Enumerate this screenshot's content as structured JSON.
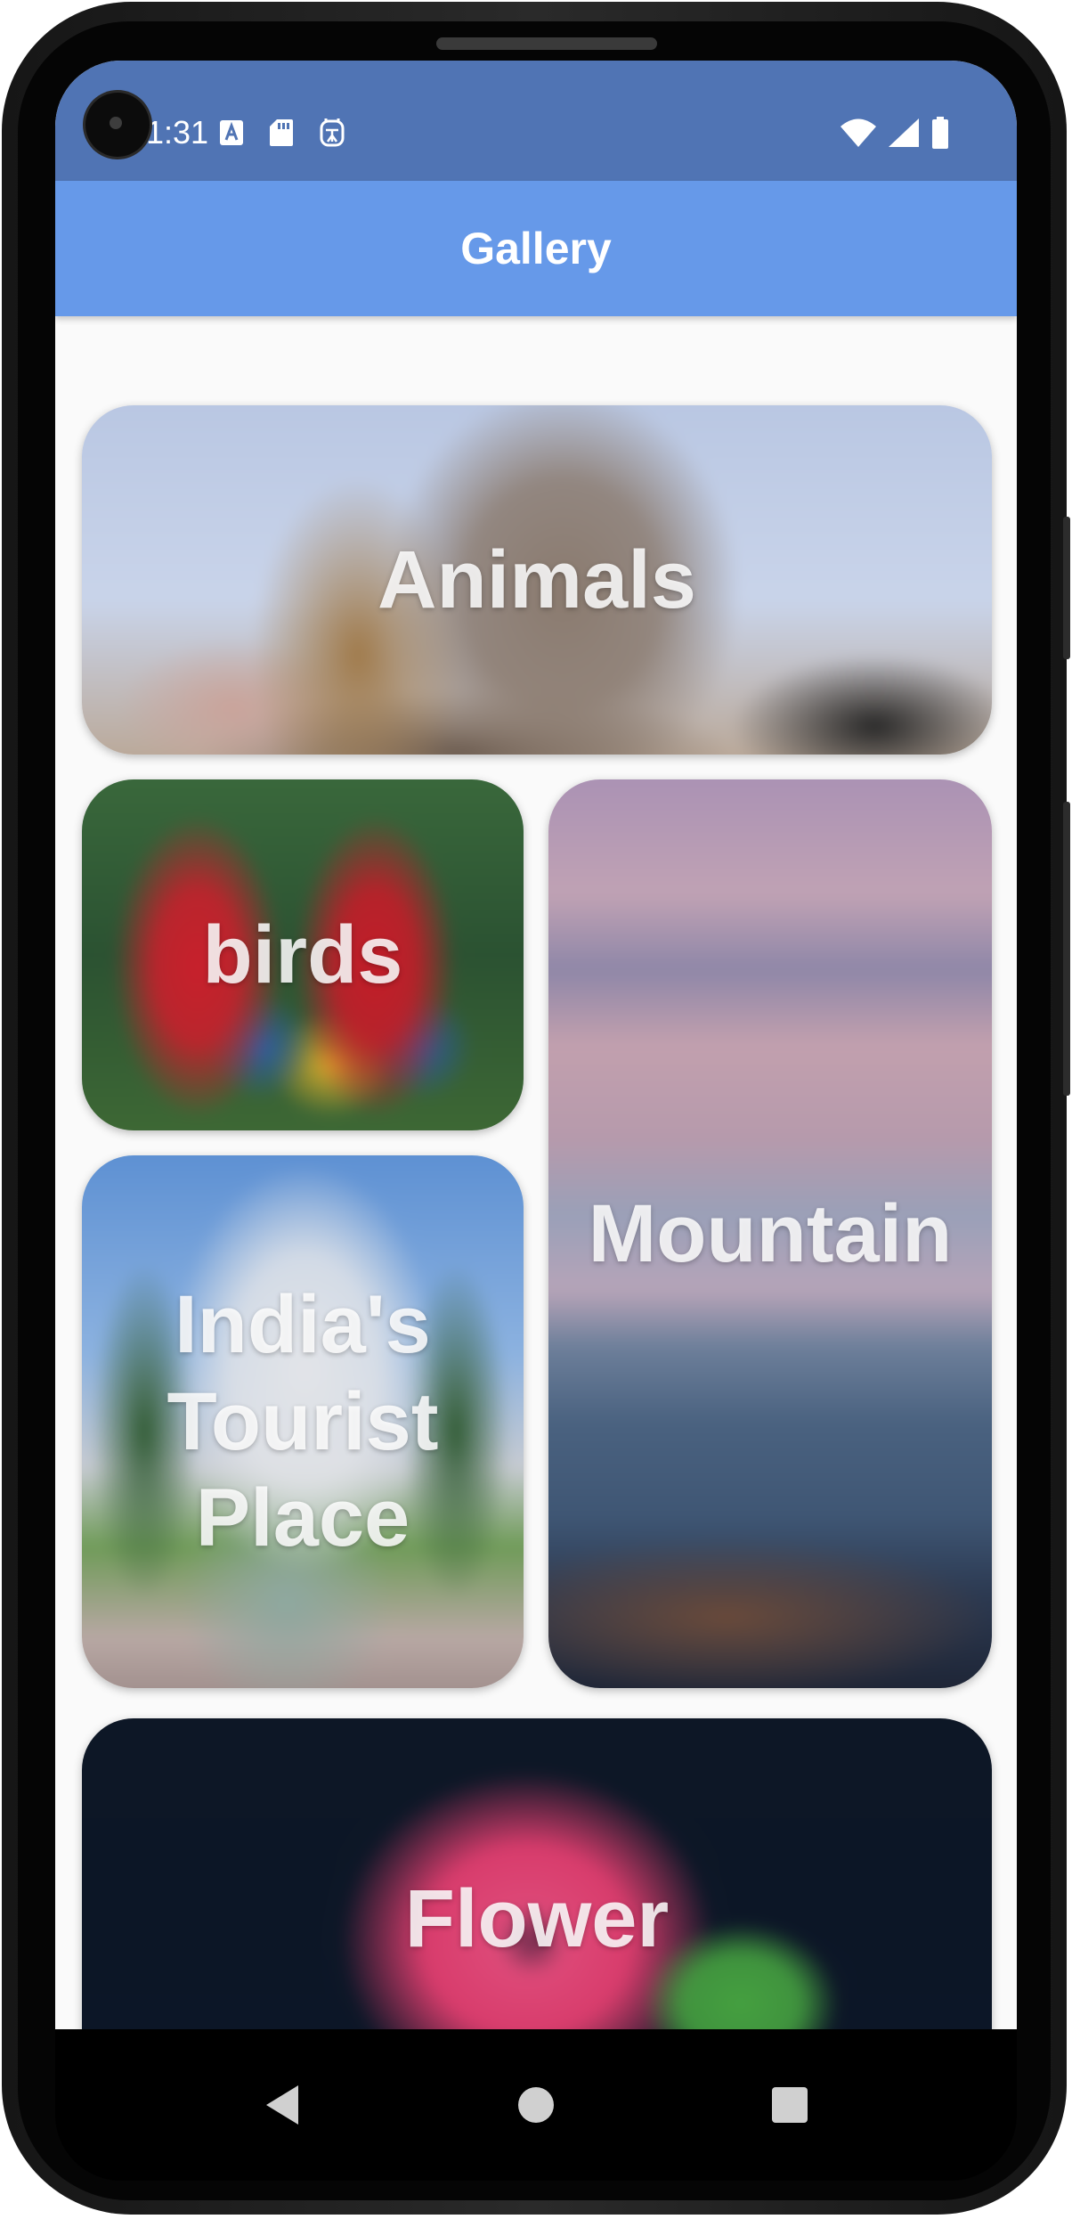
{
  "status_bar": {
    "time": "1:31",
    "left_icons": [
      "font-a-icon",
      "sd-card-icon",
      "accessibility-icon"
    ],
    "right_icons": [
      "wifi-icon",
      "signal-icon",
      "battery-icon"
    ]
  },
  "app_bar": {
    "title": "Gallery"
  },
  "gallery": {
    "items": [
      {
        "label": "Animals"
      },
      {
        "label": "birds"
      },
      {
        "label": "Mountain"
      },
      {
        "label": "India's Tourist Place"
      },
      {
        "label": "Flower"
      }
    ]
  },
  "nav_bar": {
    "icons": [
      "back-icon",
      "home-icon",
      "recents-icon"
    ]
  },
  "colors": {
    "status_bar": "#5074b4",
    "app_bar": "#6699e9",
    "background": "#fafafa"
  }
}
